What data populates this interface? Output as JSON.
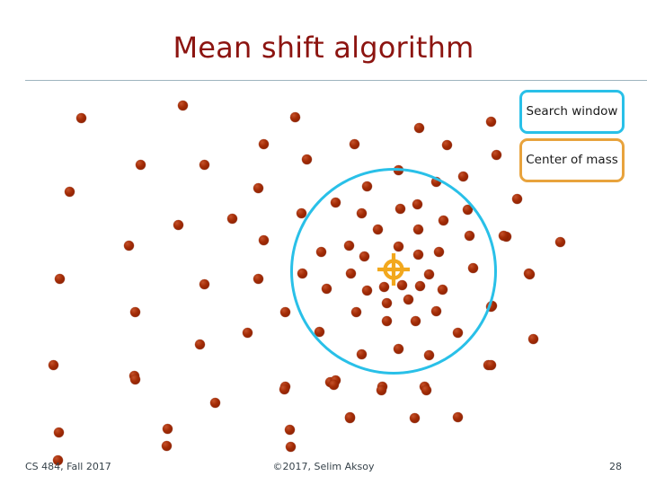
{
  "slide": {
    "title": "Mean shift algorithm",
    "title_color": "#8c1410",
    "background": "#ffffff"
  },
  "legend": {
    "search_window": {
      "label": "Search window",
      "border_color": "#29c0e8"
    },
    "center_of_mass": {
      "label": "Center of mass",
      "border_color": "#e8a33d"
    }
  },
  "footer": {
    "course": "CS 484, Fall 2017",
    "copyright": "©2017, Selim Aksoy",
    "page_number": "28"
  },
  "chart_data": {
    "type": "scatter",
    "title": "Mean shift algorithm",
    "xlabel": "",
    "ylabel": "",
    "xlim": [
      0,
      720
    ],
    "ylim": [
      0,
      405
    ],
    "grid": false,
    "legend_position": "top-right",
    "point_color": "#a32c06",
    "point_radius": 5.5,
    "series": [
      {
        "name": "data points",
        "points": [
          [
            90,
            36
          ],
          [
            203,
            22
          ],
          [
            328,
            35
          ],
          [
            394,
            65
          ],
          [
            466,
            47
          ],
          [
            546,
            40
          ],
          [
            293,
            65
          ],
          [
            341,
            82
          ],
          [
            497,
            66
          ],
          [
            552,
            77
          ],
          [
            575,
            126
          ],
          [
            156,
            88
          ],
          [
            227,
            88
          ],
          [
            443,
            94
          ],
          [
            485,
            107
          ],
          [
            515,
            101
          ],
          [
            408,
            112
          ],
          [
            287,
            114
          ],
          [
            77,
            118
          ],
          [
            373,
            130
          ],
          [
            445,
            137
          ],
          [
            402,
            142
          ],
          [
            464,
            132
          ],
          [
            520,
            138
          ],
          [
            493,
            150
          ],
          [
            563,
            168
          ],
          [
            623,
            174
          ],
          [
            335,
            142
          ],
          [
            258,
            148
          ],
          [
            198,
            155
          ],
          [
            293,
            172
          ],
          [
            143,
            178
          ],
          [
            357,
            185
          ],
          [
            420,
            160
          ],
          [
            465,
            160
          ],
          [
            522,
            167
          ],
          [
            560,
            167
          ],
          [
            388,
            178
          ],
          [
            443,
            179
          ],
          [
            488,
            185
          ],
          [
            465,
            188
          ],
          [
            405,
            190
          ],
          [
            66,
            215
          ],
          [
            227,
            221
          ],
          [
            287,
            215
          ],
          [
            336,
            209
          ],
          [
            363,
            226
          ],
          [
            390,
            209
          ],
          [
            447,
            222
          ],
          [
            427,
            224
          ],
          [
            467,
            223
          ],
          [
            477,
            210
          ],
          [
            492,
            227
          ],
          [
            526,
            203
          ],
          [
            588,
            209
          ],
          [
            408,
            228
          ],
          [
            430,
            242
          ],
          [
            454,
            238
          ],
          [
            547,
            245
          ],
          [
            396,
            252
          ],
          [
            485,
            251
          ],
          [
            589,
            210
          ],
          [
            150,
            252
          ],
          [
            317,
            252
          ],
          [
            430,
            262
          ],
          [
            462,
            262
          ],
          [
            275,
            275
          ],
          [
            222,
            288
          ],
          [
            355,
            274
          ],
          [
            509,
            275
          ],
          [
            593,
            282
          ],
          [
            443,
            293
          ],
          [
            402,
            299
          ],
          [
            477,
            300
          ],
          [
            543,
            311
          ],
          [
            59,
            311
          ],
          [
            149,
            323
          ],
          [
            317,
            335
          ],
          [
            367,
            330
          ],
          [
            373,
            328
          ],
          [
            425,
            335
          ],
          [
            472,
            335
          ],
          [
            546,
            246
          ],
          [
            546,
            311
          ],
          [
            239,
            353
          ],
          [
            186,
            382
          ],
          [
            322,
            383
          ],
          [
            65,
            386
          ],
          [
            150,
            327
          ],
          [
            316,
            338
          ],
          [
            371,
            333
          ],
          [
            424,
            339
          ],
          [
            474,
            339
          ],
          [
            389,
            369
          ],
          [
            461,
            370
          ],
          [
            509,
            369
          ],
          [
            185,
            401
          ],
          [
            323,
            402
          ],
          [
            64,
            417
          ],
          [
            389,
            370
          ]
        ]
      }
    ],
    "search_window": {
      "shape": "circle",
      "center": [
        438,
        207
      ],
      "radius": 115,
      "color": "#29c0e8",
      "stroke_width": 3
    },
    "center_of_mass": {
      "shape": "crosshair",
      "position": [
        438,
        205
      ],
      "color": "#f2a81d"
    }
  }
}
